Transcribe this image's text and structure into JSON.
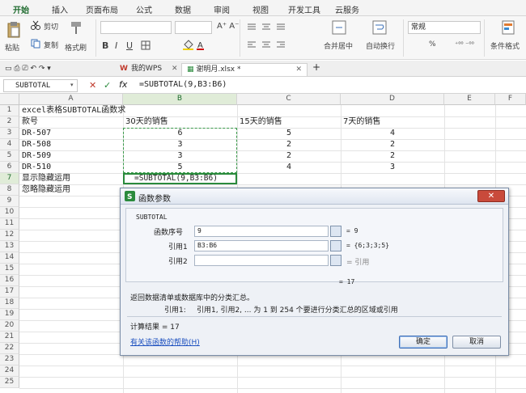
{
  "ribbon_tabs": [
    "开始",
    "插入",
    "页面布局",
    "公式",
    "数据",
    "审阅",
    "视图",
    "开发工具",
    "云服务"
  ],
  "ribbon": {
    "paste": "粘贴",
    "cut": "剪切",
    "copy": "复制",
    "format_painter": "格式刷",
    "font_bold": "B",
    "font_italic": "I",
    "font_underline": "U",
    "merge_center": "合并居中",
    "wrap_text": "自动换行",
    "number_format": "常规",
    "percent": "%",
    "conditional_format": "条件格式"
  },
  "file_tabs": {
    "wps_tab": "我的WPS",
    "doc_tab": "谢明月.xlsx *",
    "add": "+"
  },
  "formula_bar": {
    "name_box": "SUBTOTAL",
    "cancel": "✕",
    "confirm": "✓",
    "fx": "fx",
    "content": "=SUBTOTAL(9,B3:B6)"
  },
  "sheet": {
    "columns": [
      "A",
      "B",
      "C",
      "D",
      "E",
      "F"
    ],
    "rows": [
      "1",
      "2",
      "3",
      "4",
      "5",
      "6",
      "7",
      "8",
      "9",
      "10",
      "11",
      "12",
      "13",
      "14",
      "15",
      "16",
      "17",
      "18",
      "19",
      "20",
      "21",
      "22",
      "23",
      "24",
      "25"
    ],
    "cells": {
      "A1": "excel表格SUBTOTAL函数求",
      "A2": "款号",
      "B2": "30天的销售",
      "C2": "15天的销售",
      "D2": "7天的销售",
      "A3": "DR-507",
      "B3": "6",
      "C3": "5",
      "D3": "4",
      "A4": "DR-508",
      "B4": "3",
      "C4": "2",
      "D4": "2",
      "A5": "DR-509",
      "B5": "3",
      "C5": "2",
      "D5": "2",
      "A6": "DR-510",
      "B6": "5",
      "C6": "4",
      "D6": "3",
      "A7": "显示隐藏运用",
      "B7": "=SUBTOTAL(9,B3:B6)",
      "A8": "忽略隐藏运用"
    }
  },
  "dialog": {
    "title": "函数参数",
    "close": "✕",
    "function_name": "SUBTOTAL",
    "arg1_label": "函数序号",
    "arg1_value": "9",
    "arg1_result": "= 9",
    "arg2_label": "引用1",
    "arg2_value": "B3:B6",
    "arg2_result": "= {6;3;3;5}",
    "arg3_label": "引用2",
    "arg3_value": "",
    "arg3_result": "= 引用",
    "total_result": "= 17",
    "description": "返回数据清单或数据库中的分类汇总。",
    "arg_help_label": "引用1:",
    "arg_help": "引用1, 引用2, ... 为 1 到 254 个要进行分类汇总的区域或引用",
    "calc_result": "计算结果 = 17",
    "help_link": "有关该函数的帮助(H)",
    "ok": "确定",
    "cancel": "取消"
  },
  "colors": {
    "accent": "#2a8a3c",
    "dialog_border": "#7b8ea8",
    "close_red": "#c94a3b",
    "link": "#1b4fbf"
  }
}
